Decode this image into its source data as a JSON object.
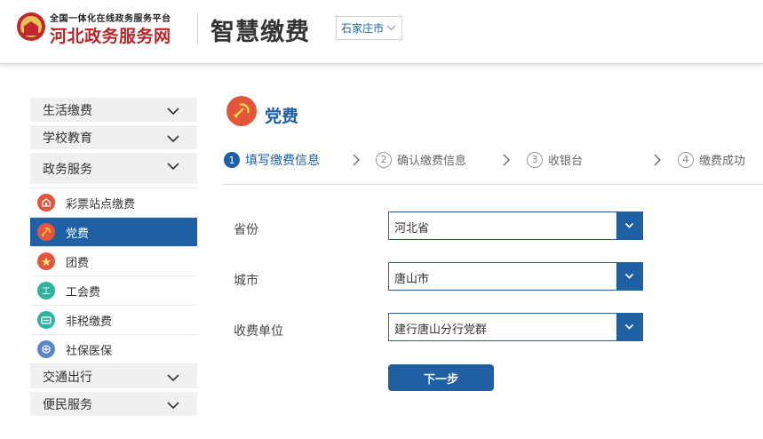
{
  "header": {
    "portal_subtitle": "全国一体化在线政务服务平台",
    "portal_name": "河北政务服务网",
    "app_title": "智慧缴费",
    "city_selector": "石家庄市"
  },
  "sidebar": {
    "categories_top": [
      {
        "label": "生活缴费"
      },
      {
        "label": "学校教育"
      },
      {
        "label": "政务服务"
      }
    ],
    "items": [
      {
        "label": "彩票站点缴费",
        "icon": "lottery-icon",
        "color": "#e4563c"
      },
      {
        "label": "党费",
        "icon": "party-emblem-icon",
        "color": "#e4563c"
      },
      {
        "label": "团费",
        "icon": "youth-league-icon",
        "color": "#e4563c"
      },
      {
        "label": "工会费",
        "icon": "union-icon",
        "color": "#2fb3a0"
      },
      {
        "label": "非税缴费",
        "icon": "non-tax-icon",
        "color": "#2fb3a0"
      },
      {
        "label": "社保医保",
        "icon": "social-insurance-icon",
        "color": "#5b86c5"
      }
    ],
    "categories_bottom": [
      {
        "label": "交通出行"
      },
      {
        "label": "便民服务"
      }
    ]
  },
  "main": {
    "title": "党费",
    "steps": [
      {
        "num": "1",
        "label": "填写缴费信息"
      },
      {
        "num": "2",
        "label": "确认缴费信息"
      },
      {
        "num": "3",
        "label": "收银台"
      },
      {
        "num": "4",
        "label": "缴费成功"
      }
    ],
    "form": {
      "province_label": "省份",
      "province_value": "河北省",
      "city_label": "城市",
      "city_value": "唐山市",
      "unit_label": "收费单位",
      "unit_value": "建行唐山分行党群"
    },
    "next_button": "下一步"
  },
  "colors": {
    "primary": "#1f5fa4",
    "brand_red": "#b7262b",
    "accent_orange": "#e4563c"
  }
}
